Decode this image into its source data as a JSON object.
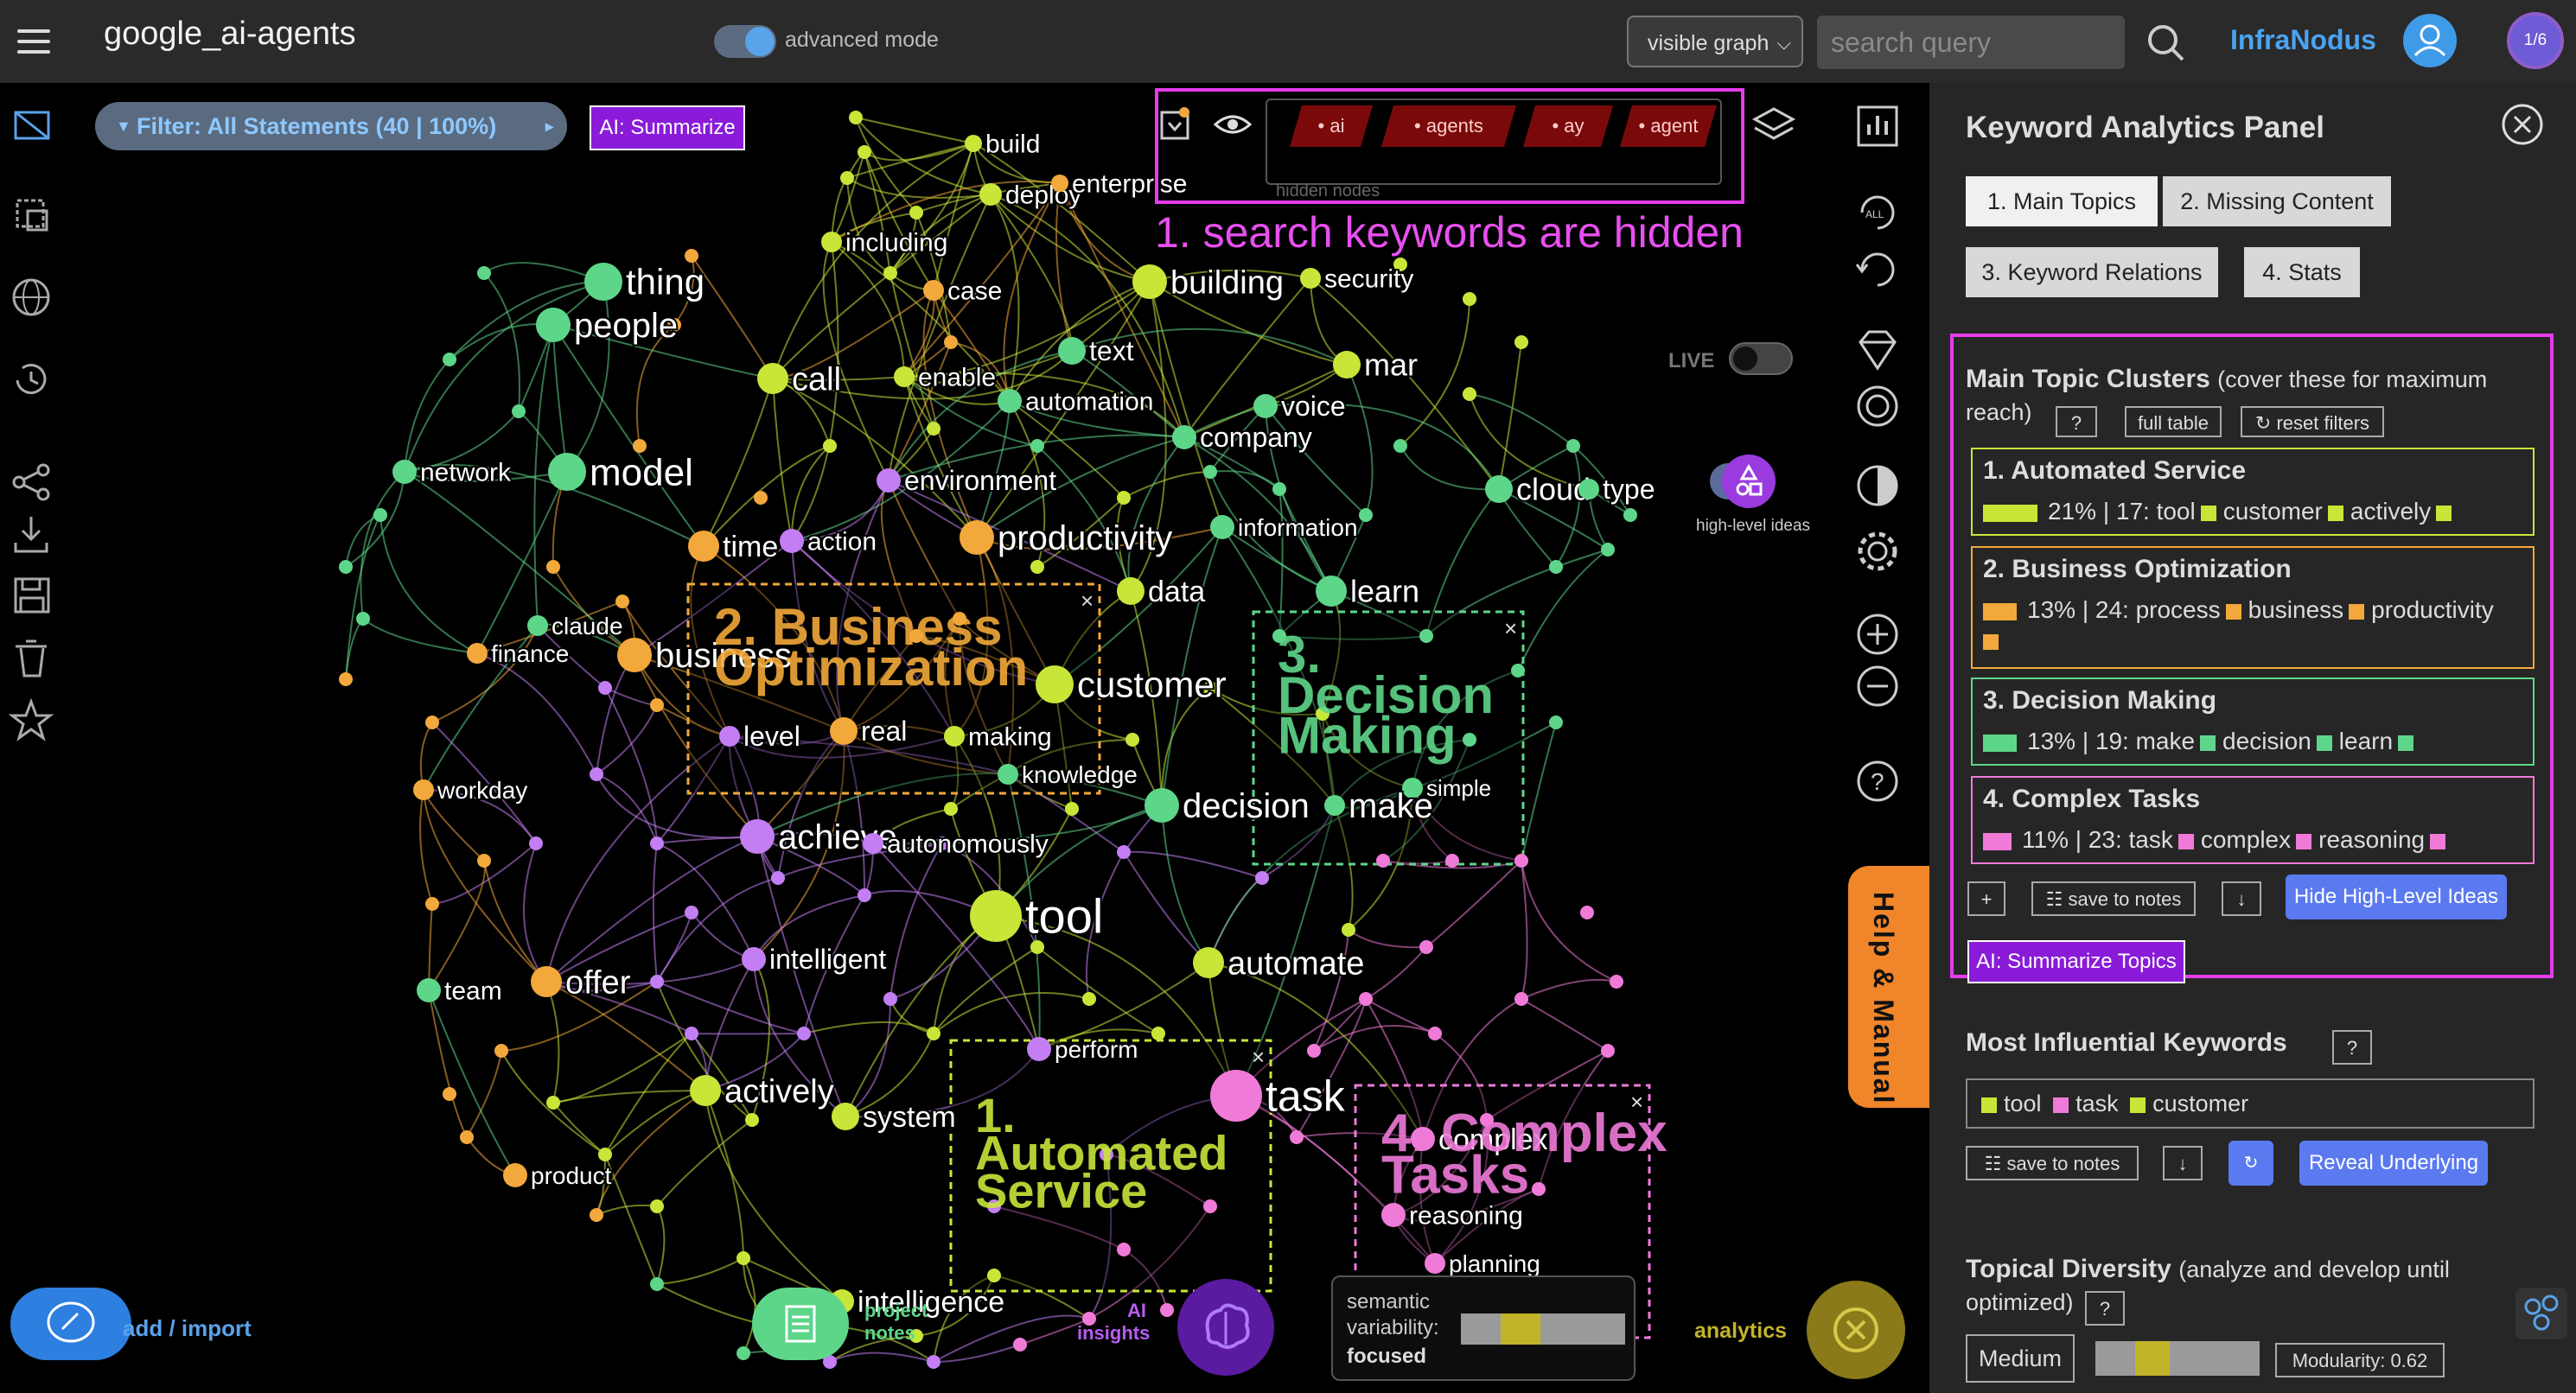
{
  "header": {
    "title": "google_ai-agents",
    "advanced_mode_label": "advanced mode",
    "view_select": "visible graph",
    "search_placeholder": "search query",
    "brand": "InfraNodus",
    "counter": "1/6"
  },
  "toolbar": {
    "filter_label": "Filter: All Statements (40 | 100%)",
    "ai_summarize": "AI: Summarize",
    "hidden_nodes": [
      "ai",
      "agents",
      "ay",
      "agent"
    ],
    "hidden_nodes_label": "hidden nodes",
    "annotation_hidden": "1. search keywords are hidden",
    "live_label": "LIVE",
    "high_level_ideas": "high-level ideas",
    "help_tab": "Help & Manual"
  },
  "colors": {
    "green": "#5ed68a",
    "lime": "#c8e638",
    "orange": "#f2a83a",
    "purple": "#c27ef2",
    "pink": "#f07ad8",
    "accent_magenta": "#e63cec"
  },
  "graph": {
    "nodes": [
      {
        "label": "build",
        "c": "lime"
      },
      {
        "label": "deploy",
        "c": "lime"
      },
      {
        "label": "enterprise",
        "c": "orange"
      },
      {
        "label": "including",
        "c": "lime"
      },
      {
        "label": "case",
        "c": "orange"
      },
      {
        "label": "building",
        "c": "lime"
      },
      {
        "label": "security",
        "c": "lime"
      },
      {
        "label": "thing",
        "c": "green"
      },
      {
        "label": "people",
        "c": "green"
      },
      {
        "label": "call",
        "c": "lime"
      },
      {
        "label": "enable",
        "c": "lime"
      },
      {
        "label": "text",
        "c": "green"
      },
      {
        "label": "automation",
        "c": "green"
      },
      {
        "label": "mar",
        "c": "lime"
      },
      {
        "label": "voice",
        "c": "green"
      },
      {
        "label": "company",
        "c": "green"
      },
      {
        "label": "network",
        "c": "green"
      },
      {
        "label": "model",
        "c": "green"
      },
      {
        "label": "environment",
        "c": "purple"
      },
      {
        "label": "cloud",
        "c": "green"
      },
      {
        "label": "type",
        "c": "green"
      },
      {
        "label": "time",
        "c": "orange"
      },
      {
        "label": "action",
        "c": "purple"
      },
      {
        "label": "productivity",
        "c": "orange"
      },
      {
        "label": "information",
        "c": "green"
      },
      {
        "label": "data",
        "c": "lime"
      },
      {
        "label": "learn",
        "c": "green"
      },
      {
        "label": "claude",
        "c": "green"
      },
      {
        "label": "finance",
        "c": "orange"
      },
      {
        "label": "business",
        "c": "orange"
      },
      {
        "label": "customer",
        "c": "lime"
      },
      {
        "label": "level",
        "c": "purple"
      },
      {
        "label": "real",
        "c": "orange"
      },
      {
        "label": "making",
        "c": "lime"
      },
      {
        "label": "knowledge",
        "c": "green"
      },
      {
        "label": "workday",
        "c": "orange"
      },
      {
        "label": "simple",
        "c": "green"
      },
      {
        "label": "decision",
        "c": "green"
      },
      {
        "label": "make",
        "c": "green"
      },
      {
        "label": "achieve",
        "c": "purple"
      },
      {
        "label": "autonomously",
        "c": "purple"
      },
      {
        "label": "tool",
        "c": "lime"
      },
      {
        "label": "intelligent",
        "c": "purple"
      },
      {
        "label": "automate",
        "c": "lime"
      },
      {
        "label": "team",
        "c": "green"
      },
      {
        "label": "offer",
        "c": "orange"
      },
      {
        "label": "perform",
        "c": "purple"
      },
      {
        "label": "task",
        "c": "pink"
      },
      {
        "label": "actively",
        "c": "lime"
      },
      {
        "label": "system",
        "c": "lime"
      },
      {
        "label": "complex",
        "c": "pink"
      },
      {
        "label": "product",
        "c": "orange"
      },
      {
        "label": "reasoning",
        "c": "pink"
      },
      {
        "label": "planning",
        "c": "pink"
      },
      {
        "label": "intelligence",
        "c": "lime"
      }
    ],
    "clusters": [
      {
        "label": "1. Automated Service",
        "c": "lime"
      },
      {
        "label": "2. Business Optimization",
        "c": "orange"
      },
      {
        "label": "3. Decision Making",
        "c": "green"
      },
      {
        "label": "4. Complex Tasks",
        "c": "pink"
      }
    ]
  },
  "bottom": {
    "add_import": "add / import",
    "project_notes": "project notes",
    "ai_insights": "AI insights",
    "semantic_label": "semantic variability:",
    "semantic_value": "focused",
    "analytics": "analytics"
  },
  "panel": {
    "title": "Keyword Analytics Panel",
    "tabs": [
      "1. Main Topics",
      "2. Missing Content",
      "3. Keyword Relations",
      "4. Stats"
    ],
    "main_topics_title": "Main Topic Clusters",
    "main_topics_hint": "(cover these for maximum",
    "main_topics_hint2": "reach)",
    "full_table": "full table",
    "reset_filters": "↻ reset filters",
    "clusters": [
      {
        "title": "1. Automated Service",
        "pct": "21%",
        "count": "17:",
        "words": [
          "tool",
          "customer",
          "actively"
        ],
        "fill": 0.21,
        "color": "#c8e638"
      },
      {
        "title": "2. Business Optimization",
        "pct": "13%",
        "count": "24:",
        "words": [
          "process",
          "business",
          "productivity"
        ],
        "fill": 0.13,
        "color": "#f2a83a"
      },
      {
        "title": "3. Decision Making",
        "pct": "13%",
        "count": "19:",
        "words": [
          "make",
          "decision",
          "learn"
        ],
        "fill": 0.13,
        "color": "#5ed68a"
      },
      {
        "title": "4. Complex Tasks",
        "pct": "11%",
        "count": "23:",
        "words": [
          "task",
          "complex",
          "reasoning"
        ],
        "fill": 0.11,
        "color": "#f07ad8"
      }
    ],
    "save_to_notes": "save to notes",
    "hide_high_level": "Hide High-Level Ideas",
    "ai_summarize_topics": "AI: Summarize Topics",
    "influential_title": "Most Influential Keywords",
    "influential_words": [
      "tool",
      "task",
      "customer"
    ],
    "reveal_underlying": "Reveal Underlying",
    "diversity_title": "Topical Diversity",
    "diversity_hint": "(analyze and develop until",
    "diversity_hint2": "optimized)",
    "diversity_value": "Medium",
    "modularity": "Modularity: 0.62"
  }
}
